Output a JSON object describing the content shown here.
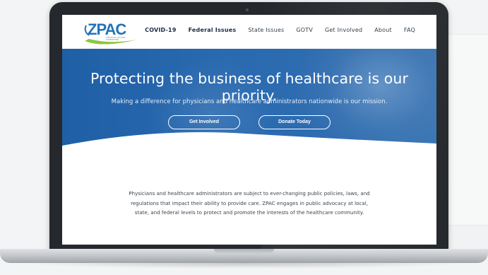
{
  "site": {
    "logo_text": "ZPAC",
    "logo_subtext": "POLITICAL ACTION COMMITTEE",
    "nav": [
      {
        "label": "COVID-19"
      },
      {
        "label": "Federal Issues"
      },
      {
        "label": "State Issues"
      },
      {
        "label": "GOTV"
      },
      {
        "label": "Get Involved"
      },
      {
        "label": "About"
      },
      {
        "label": "FAQ"
      }
    ],
    "hero": {
      "title": "Protecting the business of healthcare is our priority.",
      "subtitle": "Making a difference for physicians and healthcare administrators nationwide is our mission.",
      "buttons": [
        {
          "label": "Get Involved"
        },
        {
          "label": "Donate Today"
        }
      ]
    },
    "intro_text": "Physicians and healthcare administrators are subject to ever-changing public policies, laws, and regulations that impact their ability to provide care. ZPAC engages in public advocacy at local, state, and federal levels to protect and promote the interests of the healthcare community."
  },
  "colors": {
    "hero_blue": "#2a6ab0",
    "logo_blue": "#2173b8",
    "logo_green": "#8cc63f",
    "laptop_bezel": "#25282c"
  }
}
